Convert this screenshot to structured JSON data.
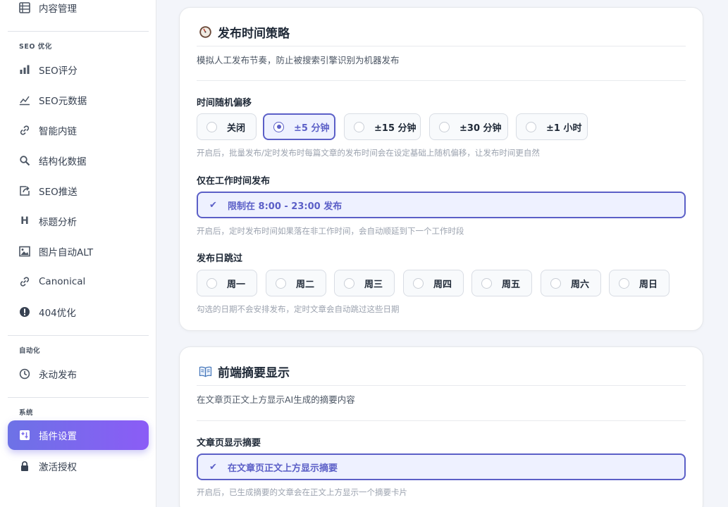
{
  "sidebar": {
    "top_item": {
      "label": "内容管理"
    },
    "groups": {
      "seo": "SEO 优化",
      "automation": "自动化",
      "system": "系统"
    },
    "seo_items": [
      {
        "label": "SEO评分"
      },
      {
        "label": "SEO元数据"
      },
      {
        "label": "智能内链"
      },
      {
        "label": "结构化数据"
      },
      {
        "label": "SEO推送"
      },
      {
        "label": "标题分析"
      },
      {
        "label": "图片自动ALT"
      },
      {
        "label": "Canonical"
      },
      {
        "label": "404优化"
      }
    ],
    "automation_items": [
      {
        "label": "永动发布"
      }
    ],
    "system_items": [
      {
        "label": "插件设置"
      },
      {
        "label": "激活授权"
      }
    ]
  },
  "publish_card": {
    "title": "发布时间策略",
    "description": "模拟人工发布节奏，防止被搜索引擎识别为机器发布",
    "random_offset": {
      "label": "时间随机偏移",
      "options": [
        "关闭",
        "±5 分钟",
        "±15 分钟",
        "±30 分钟",
        "±1 小时"
      ],
      "selected": "±5 分钟",
      "hint": "开启后，批量发布/定时发布时每篇文章的发布时间会在设定基础上随机偏移，让发布时间更自然"
    },
    "work_hours": {
      "label": "仅在工作时间发布",
      "checkbox_label": "限制在 8:00 - 23:00 发布",
      "checked": true,
      "hint": "开启后，定时发布时间如果落在非工作时间，会自动顺延到下一个工作时段"
    },
    "skip_days": {
      "label": "发布日跳过",
      "days": [
        "周一",
        "周二",
        "周三",
        "周四",
        "周五",
        "周六",
        "周日"
      ],
      "hint": "勾选的日期不会安排发布，定时文章会自动跳过这些日期"
    }
  },
  "summary_card": {
    "title": "前端摘要显示",
    "description": "在文章页正文上方显示AI生成的摘要内容",
    "show_summary": {
      "label": "文章页显示摘要",
      "checkbox_label": "在文章页正文上方显示摘要",
      "checked": true,
      "hint": "开启后，已生成摘要的文章会在正文上方显示一个摘要卡片"
    }
  },
  "colors": {
    "accent": "#5b5fc7",
    "active_gradient_start": "#6d72e6",
    "active_gradient_end": "#8b5cf6"
  }
}
